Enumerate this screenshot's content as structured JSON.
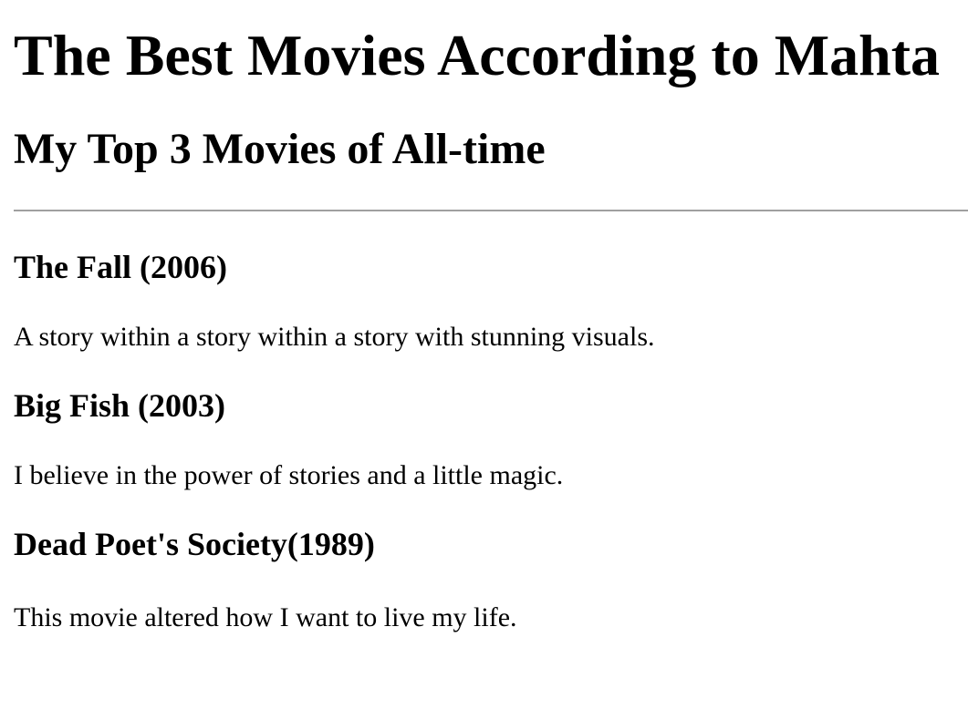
{
  "page": {
    "title": "The Best Movies According to Mahta",
    "subtitle": "My Top 3 Movies of All-time"
  },
  "movies": [
    {
      "title": "The Fall (2006)",
      "description": "A story within a story within a story with stunning visuals."
    },
    {
      "title": "Big Fish (2003)",
      "description": "I believe in the power of stories and a little magic."
    },
    {
      "title": "Dead Poet's Society(1989)",
      "description": "This movie altered how I want to live my life."
    }
  ]
}
